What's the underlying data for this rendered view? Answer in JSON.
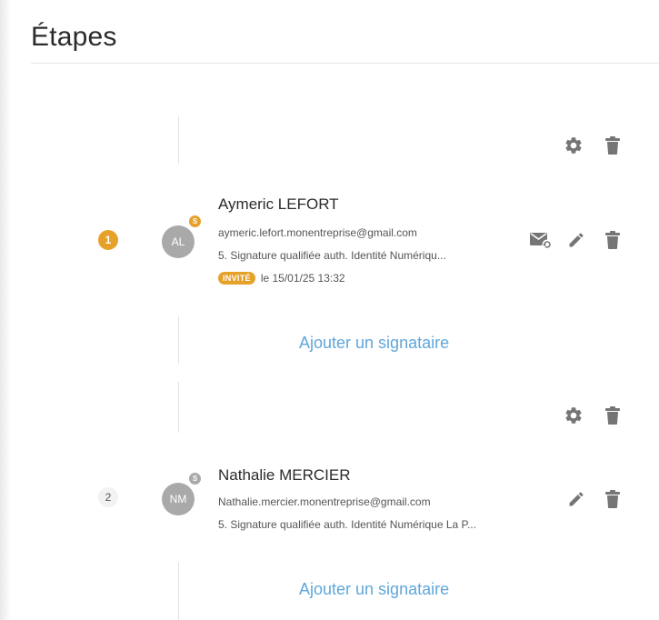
{
  "page": {
    "title": "Étapes"
  },
  "steps": [
    {
      "number": "1",
      "signer": {
        "name": "Aymeric LEFORT",
        "initials": "AL",
        "badge_letter": "S",
        "email": "aymeric.lefort.monentreprise@gmail.com",
        "signature_type": "5. Signature qualifiée auth. Identité Numériqu...",
        "status": "INVITÉ",
        "status_date": "le 15/01/25 13:32"
      },
      "add_signer_label": "Ajouter un signataire"
    },
    {
      "number": "2",
      "signer": {
        "name": "Nathalie MERCIER",
        "initials": "NM",
        "badge_letter": "S",
        "email": "Nathalie.mercier.monentreprise@gmail.com",
        "signature_type": "5. Signature qualifiée auth. Identité Numérique La P..."
      },
      "add_signer_label": "Ajouter un signataire"
    }
  ],
  "colors": {
    "accent": "#e5a12a",
    "link": "#5fa7da",
    "icon": "#757575"
  },
  "icons": [
    "gear-icon",
    "trash-icon",
    "resend-mail-icon",
    "pencil-icon"
  ]
}
